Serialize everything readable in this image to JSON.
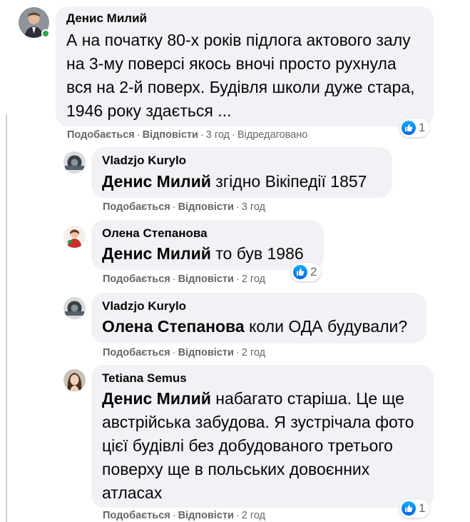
{
  "comments": [
    {
      "author": "Денис Милий",
      "text": "А на початку 80-х років підлога актового залу на 3-му поверсі якось вночі просто рухнула вся на 2-й поверх. Будівля школи дуже стара, 1946 року здається ...",
      "like_label": "Подобається",
      "reply_label": "Відповісти",
      "time": "3 год",
      "edited": "Відредаговано",
      "reactions": "1"
    },
    {
      "author": "Vladzjo Kurylo",
      "mention": "Денис Милий",
      "text": " згідно Вікіпедії 1857",
      "like_label": "Подобається",
      "reply_label": "Відповісти",
      "time": "3 год"
    },
    {
      "author": "Олена Степанова",
      "mention": "Денис Милий",
      "text": " то був 1986",
      "like_label": "Подобається",
      "reply_label": "Відповісти",
      "time": "2 год",
      "reactions": "2"
    },
    {
      "author": "Vladzjo Kurylo",
      "mention": "Олена Степанова",
      "text": " коли ОДА будували?",
      "like_label": "Подобається",
      "reply_label": "Відповісти",
      "time": "2 год"
    },
    {
      "author": "Tetiana Semus",
      "mention": "Денис Милий",
      "text": " набагато старіша. Це ще австрійська забудова. Я зустрічала фото цієї будівлі без добудованого третього поверху ще в польських довоєнних атласах",
      "like_label": "Подобається",
      "reply_label": "Відповісти",
      "time": "2 год",
      "reactions": "1"
    }
  ],
  "colors": {
    "bubble": "#f0f2f5",
    "meta": "#65676b",
    "like_blue": "#0a7cff",
    "online": "#31a24c"
  }
}
